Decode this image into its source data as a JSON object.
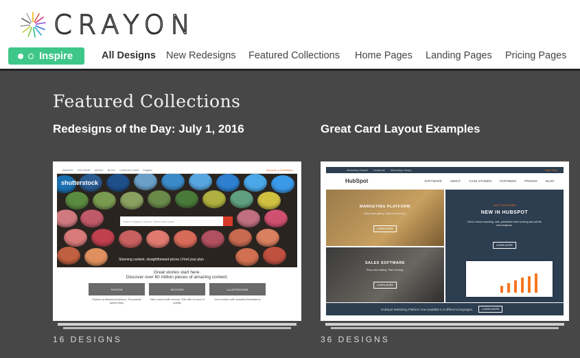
{
  "brand": {
    "name": "CRAYON"
  },
  "nav": {
    "inspire_label": "Inspire",
    "items": [
      "All Designs",
      "New Redesigns",
      "Featured Collections",
      "Home Pages",
      "Landing Pages",
      "Pricing Pages"
    ],
    "active": "All Designs"
  },
  "main": {
    "section_title": "Featured Collections",
    "cards": [
      {
        "title": "Redesigns of the Day: July 1, 2016",
        "count": "16 DESIGNS",
        "preview": {
          "top_links": [
            "IMAGES",
            "FOOTAGE",
            "MUSIC",
            "BLOG",
            "1-800-814-7604",
            "English"
          ],
          "top_right": "Become a Contributor",
          "logo": "shutterstock",
          "search_placeholder": "Search images, vectors, videos and music",
          "search_filter": "All Images",
          "hero_caption": "Stunning content, straightforward prices  |  Find your plan",
          "headline_1": "Great stories start here.",
          "headline_2": "Discover over 80 million pieces of amazing content.",
          "tiles": [
            {
              "label": "PHOTOS",
              "text": "Explore professional photos. Thousands added daily"
            },
            {
              "label": "VECTORS",
              "text": "Take control with vectors. Edit with no loss of quality"
            },
            {
              "label": "ILLUSTRATIONS",
              "text": "Get creative with beautiful illustrations"
            }
          ]
        }
      },
      {
        "title": "Great Card Layout Examples",
        "count": "36 DESIGNS",
        "preview": {
          "top_links": [
            "Marketing Grader",
            "Academy",
            "Marketing Library"
          ],
          "top_right": "Free Trial",
          "brand": "HubSpot",
          "nav_links": [
            "SOFTWARE",
            "ABOUT",
            "CASE STUDIES",
            "PARTNERS",
            "PRICING",
            "BLOG"
          ],
          "panel_a_title": "MARKETING PLATFORM",
          "panel_a_sub": "Stop interrupting. Start connecting.",
          "panel_b_title": "SALES SOFTWARE",
          "panel_b_sub": "Stop cold calling. Start closing.",
          "panel_c_kicker": "JUST LAUNCHED",
          "panel_c_title": "NEW IN HUBSPOT",
          "panel_c_sub": "Get to know reporting, ads, predictive lead scoring and all the new features.",
          "learn_more": "LEARN MORE",
          "footer_text": "HubSpot Marketing Platform now available in 5 different languages.",
          "footer_btn": "LEARN MORE"
        }
      }
    ]
  },
  "colors": {
    "accent_green": "#3fc789",
    "dark_bg": "#474747",
    "hubspot_orange": "#f7761f",
    "hubspot_navy": "#2d3e50",
    "shutterstock_red": "#d83a2a"
  }
}
